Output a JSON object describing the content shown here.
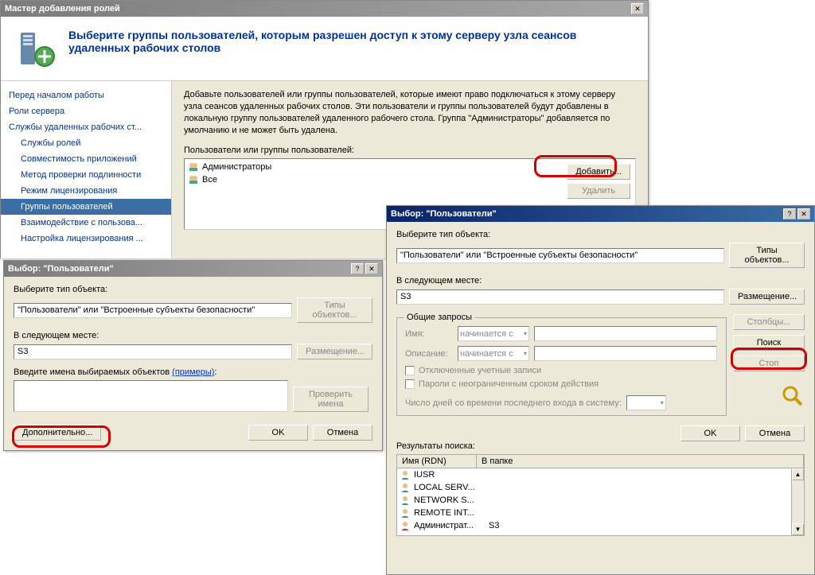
{
  "wizard": {
    "title": "Мастер добавления ролей",
    "heading": "Выберите группы пользователей, которым разрешен доступ к этому серверу узла сеансов удаленных рабочих столов",
    "nav": [
      "Перед началом работы",
      "Роли сервера",
      "Службы удаленных рабочих ст...",
      "Службы ролей",
      "Совместимость приложений",
      "Метод проверки подлинности",
      "Режим лицензирования",
      "Группы пользователей",
      "Взаимодействие с пользова...",
      "Настройка лицензирования ..."
    ],
    "desc": "Добавьте пользователей или группы пользователей, которые имеют право подключаться к этому серверу узла сеансов удаленных рабочих столов. Эти пользователи и группы пользователей будут добавлены в локальную группу пользователей удаленного рабочего стола. Группа \"Администраторы\" добавляется по умолчанию и не может быть удалена.",
    "list_label": "Пользователи или группы пользователей:",
    "items": [
      "Администраторы",
      "Все"
    ],
    "add_btn": "Добавить...",
    "del_btn": "Удалить"
  },
  "dlg1": {
    "title": "Выбор: \"Пользователи\"",
    "obj_type_label": "Выберите тип объекта:",
    "obj_type_value": "\"Пользователи\" или \"Встроенные субъекты безопасности\"",
    "types_btn": "Типы объектов...",
    "loc_label": "В следующем месте:",
    "loc_value": "S3",
    "loc_btn": "Размещение...",
    "names_label": "Введите имена выбираемых объектов",
    "examples": "(примеры)",
    "check_btn": "Проверить имена",
    "adv_btn": "Дополнительно...",
    "ok": "OK",
    "cancel": "Отмена"
  },
  "dlg2": {
    "title": "Выбор: \"Пользователи\"",
    "obj_type_label": "Выберите тип объекта:",
    "obj_type_value": "\"Пользователи\" или \"Встроенные субъекты безопасности\"",
    "types_btn": "Типы объектов...",
    "loc_label": "В следующем месте:",
    "loc_value": "S3",
    "loc_btn": "Размещение...",
    "group_title": "Общие запросы",
    "name_label": "Имя:",
    "desc_label": "Описание:",
    "starts_with": "начинается с",
    "chk1": "Отключенные учетные записи",
    "chk2": "Пароли с неограниченным сроком действия",
    "days_label": "Число дней со времени последнего входа в систему:",
    "cols_btn": "Столбцы...",
    "search_btn": "Поиск",
    "stop_btn": "Стоп",
    "ok": "OK",
    "cancel": "Отмена",
    "results_label": "Результаты поиска:",
    "col_name": "Имя (RDN)",
    "col_folder": "В папке",
    "results": [
      {
        "name": "IUSR",
        "folder": ""
      },
      {
        "name": "LOCAL SERV...",
        "folder": ""
      },
      {
        "name": "NETWORK S...",
        "folder": ""
      },
      {
        "name": "REMOTE INT...",
        "folder": ""
      },
      {
        "name": "Администрат...",
        "folder": "S3"
      }
    ]
  }
}
